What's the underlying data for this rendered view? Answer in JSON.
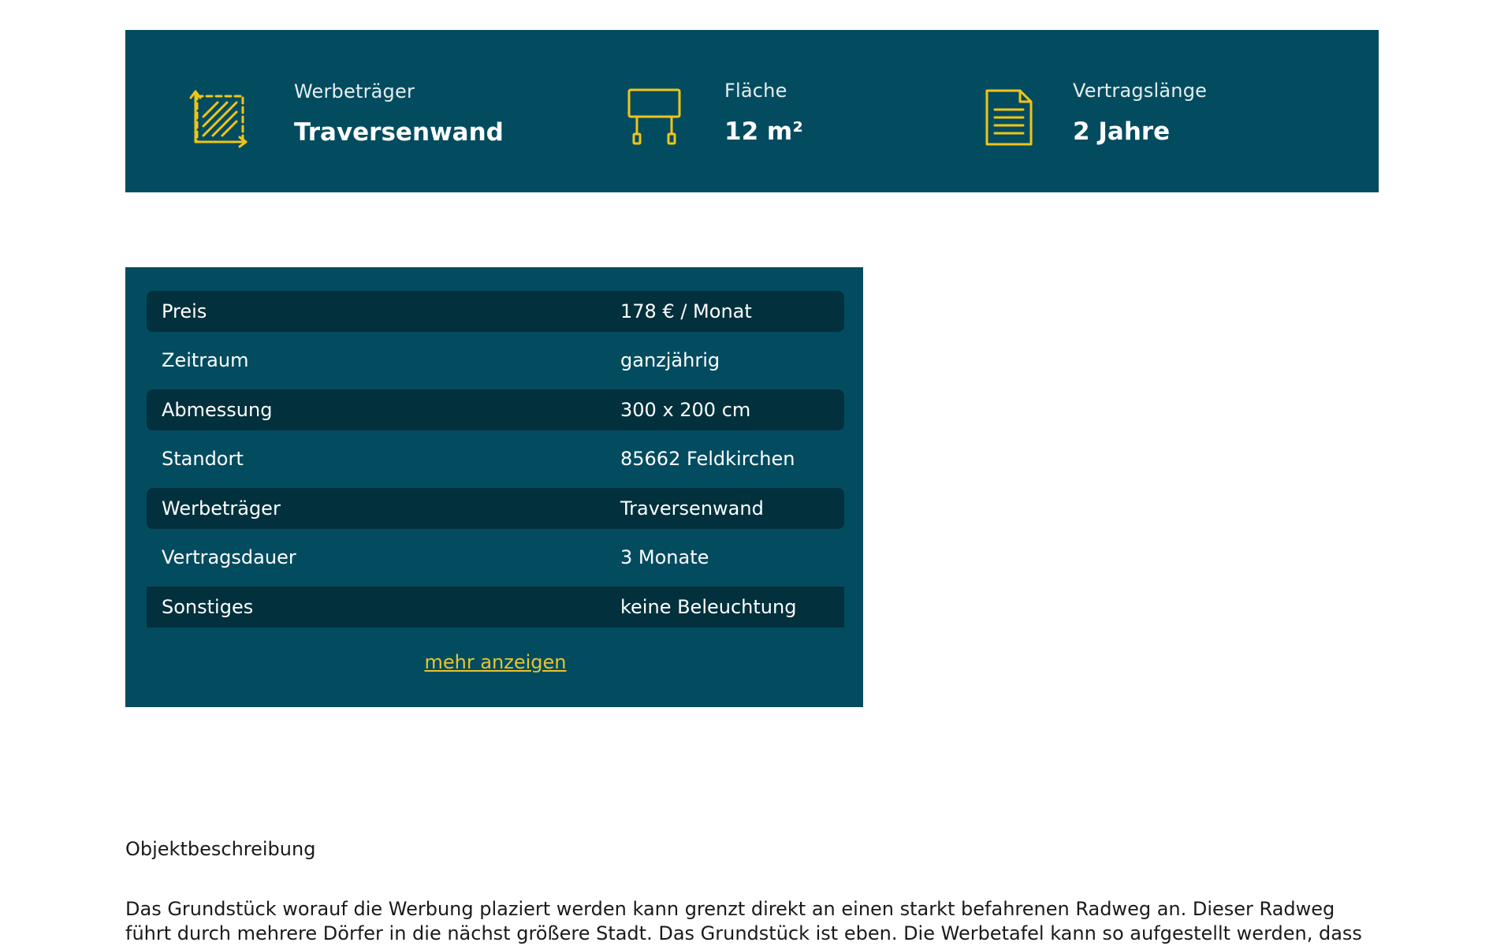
{
  "features": [
    {
      "icon": "resize-area-icon",
      "label": "Werbeträger",
      "value": "Traversenwand"
    },
    {
      "icon": "billboard-icon",
      "label": "Fläche",
      "value": "12 m²"
    },
    {
      "icon": "document-icon",
      "label": "Vertragslänge",
      "value": "2 Jahre"
    }
  ],
  "details": {
    "rows": [
      {
        "key": "Preis",
        "value": "178 € / Monat"
      },
      {
        "key": "Zeitraum",
        "value": "ganzjährig"
      },
      {
        "key": "Abmessung",
        "value": "300 x 200 cm"
      },
      {
        "key": "Standort",
        "value": "85662 Feldkirchen"
      },
      {
        "key": "Werbeträger",
        "value": "Traversenwand"
      },
      {
        "key": "Vertragsdauer",
        "value": "3 Monate"
      },
      {
        "key": "Sonstiges",
        "value": "keine Beleuchtung"
      }
    ],
    "more_label": "mehr anzeigen"
  },
  "description": {
    "title": "Objektbeschreibung",
    "text": "Das Grundstück worauf die Werbung plaziert werden kann grenzt direkt an einen starkt befahrenen Radweg an. Dieser Radweg führt durch mehrere Dörfer in die nächst größere Stadt. Das Grundstück ist eben. Die Werbetafel kann so aufgestellt werden, dass sie ais beiden"
  },
  "colors": {
    "panel": "#034c60",
    "row_dark": "#02303d",
    "accent": "#e7c431"
  }
}
